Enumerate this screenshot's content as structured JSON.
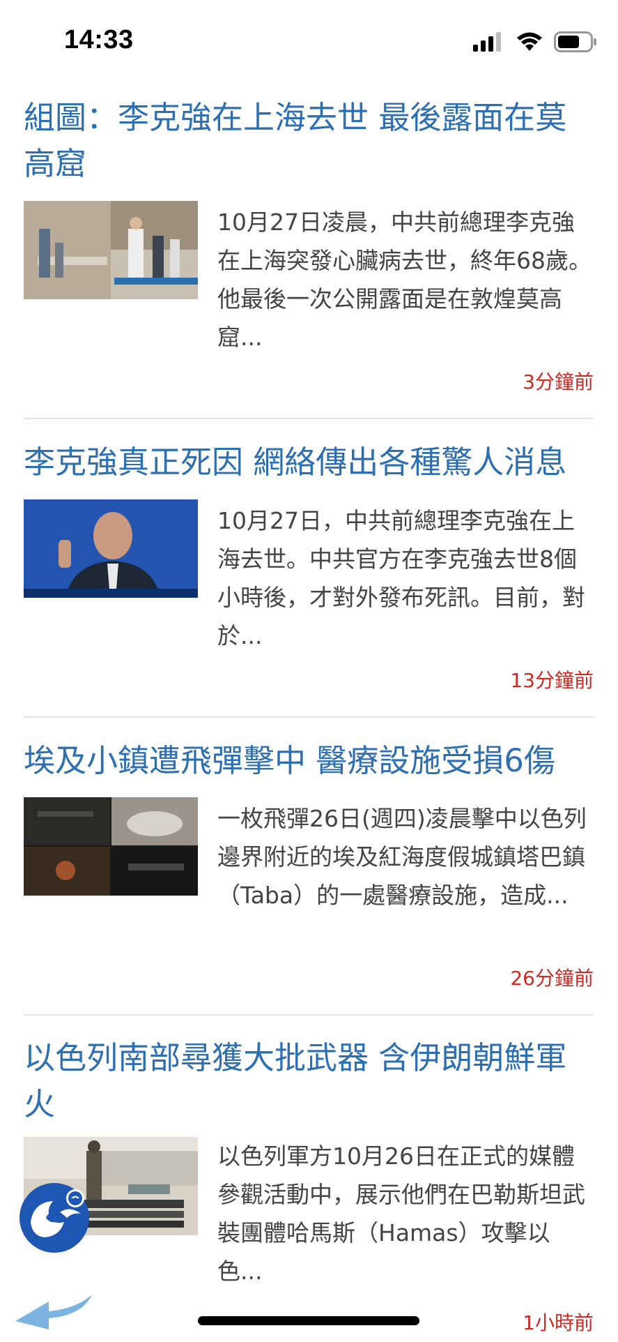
{
  "status_bar": {
    "time": "14:33"
  },
  "articles": [
    {
      "title": "組圖：李克強在上海去世 最後露面在莫高窟",
      "summary": "10月27日凌晨，中共前總理李克強在上海突發心臟病去世，終年68歲。他最後一次公開露面是在敦煌莫高窟...",
      "time": "3分鐘前",
      "image": "photo of people walking at Mogao Caves"
    },
    {
      "title": "李克強真正死因 網絡傳出各種驚人消息",
      "summary": "10月27日，中共前總理李克強在上海去世。中共官方在李克強去世8個小時後，才對外發布死訊。目前，對於...",
      "time": "13分鐘前",
      "image": "photo of man speaking at press conference"
    },
    {
      "title": "埃及小鎮遭飛彈擊中 醫療設施受損6傷",
      "summary": "一枚飛彈26日(週四)凌晨擊中以色列邊界附近的埃及紅海度假城鎮塔巴鎮（Taba）的一處醫療設施，造成...",
      "time": "26分鐘前",
      "image": "collage of damaged building and vehicle"
    },
    {
      "title": "以色列南部尋獲大批武器 含伊朗朝鮮軍火",
      "summary": "以色列軍方10月26日在正式的媒體參觀活動中，展示他們在巴勒斯坦武裝團體哈馬斯（Hamas）攻擊以色...",
      "time": "1小時前",
      "image": "photo of seized weapons on display"
    }
  ],
  "colors": {
    "title": "#2c6fb3",
    "summary": "#444444",
    "timestamp": "#cc2a22",
    "divider": "#e4e4e4"
  },
  "icons": {
    "cellular": "signal-bars-icon",
    "wifi": "wifi-icon",
    "battery": "battery-icon",
    "app_logo": "app-logo-icon",
    "back": "back-arrow-icon"
  }
}
